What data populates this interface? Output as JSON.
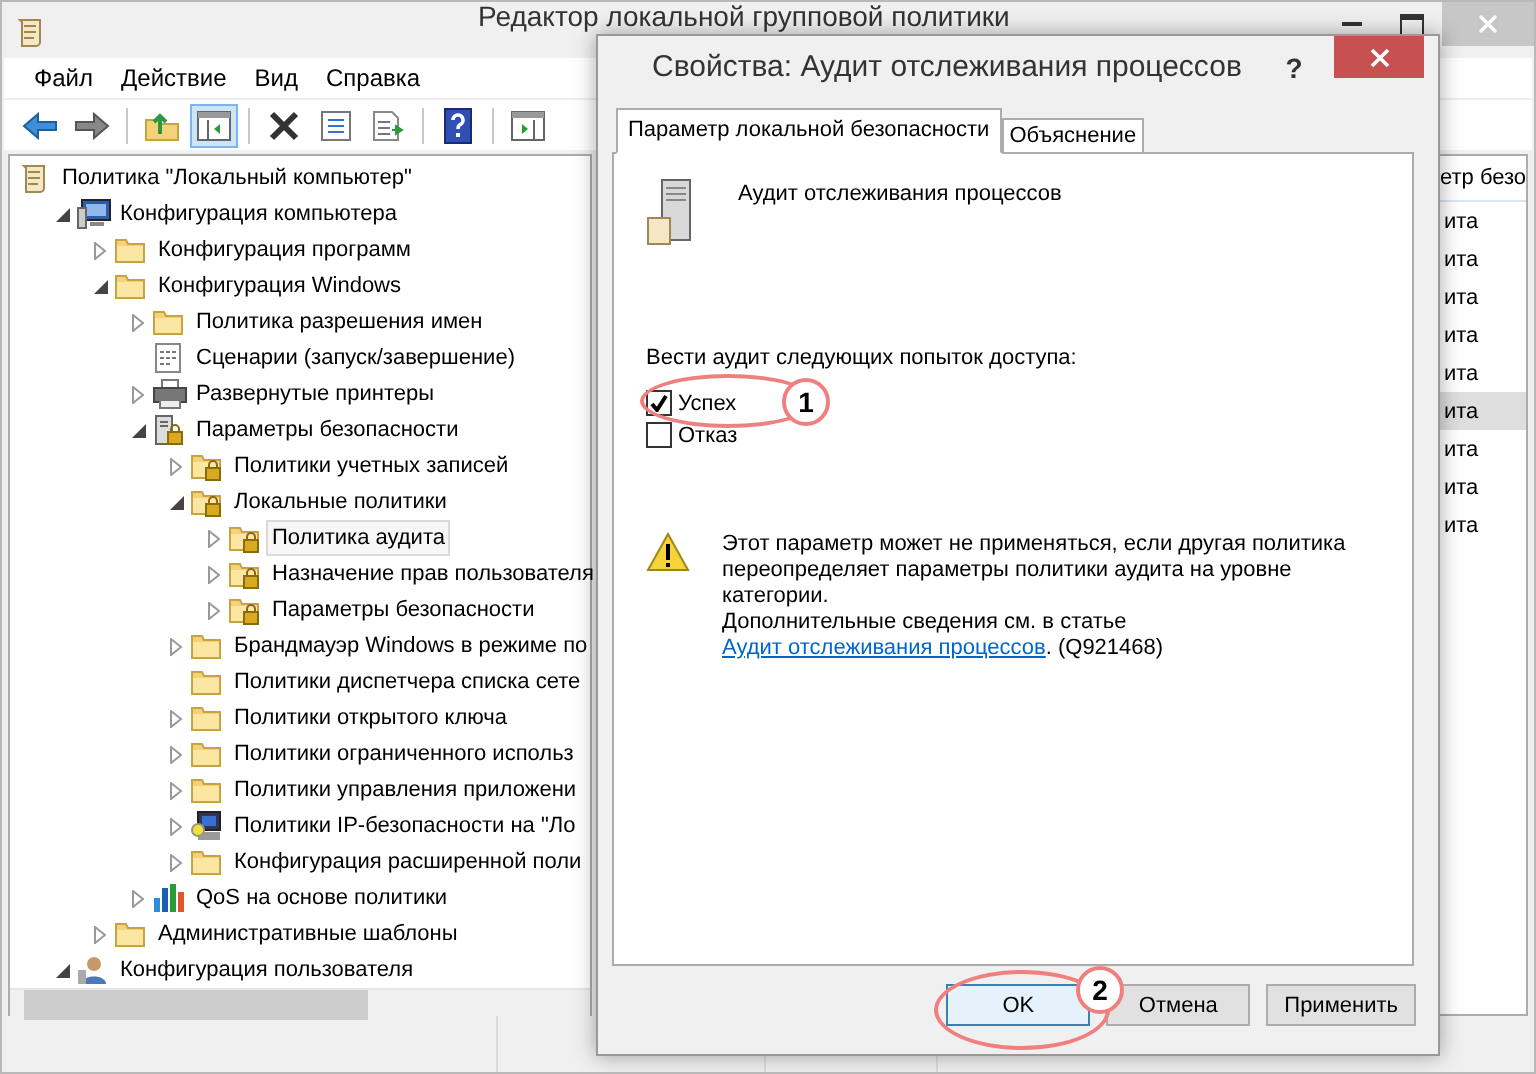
{
  "window": {
    "title": "Редактор локальной групповой политики"
  },
  "menu": [
    "Файл",
    "Действие",
    "Вид",
    "Справка"
  ],
  "toolbar": [
    {
      "kind": "back",
      "pressed": false
    },
    {
      "kind": "forward",
      "pressed": false
    },
    {
      "kind": "up",
      "pressed": false
    },
    {
      "kind": "tree-toggle",
      "pressed": true
    },
    {
      "kind": "delete",
      "pressed": false
    },
    {
      "kind": "properties",
      "pressed": false
    },
    {
      "kind": "export",
      "pressed": false
    },
    {
      "kind": "help",
      "pressed": false
    },
    {
      "kind": "action-pane",
      "pressed": false
    }
  ],
  "tree": [
    {
      "label": "Политика \"Локальный компьютер\"",
      "kind": "scroll",
      "selected": false,
      "children": [
        {
          "label": "Конфигурация компьютера",
          "kind": "computer",
          "expanded": true,
          "selected": false,
          "children": [
            {
              "label": "Конфигурация программ",
              "kind": "folder",
              "expanded": false,
              "selected": false
            },
            {
              "label": "Конфигурация Windows",
              "kind": "folder",
              "expanded": true,
              "selected": false,
              "children": [
                {
                  "label": "Политика разрешения имен",
                  "kind": "folder",
                  "expanded": false,
                  "selected": false
                },
                {
                  "label": "Сценарии (запуск/завершение)",
                  "kind": "script",
                  "selected": false
                },
                {
                  "label": "Развернутые принтеры",
                  "kind": "printer",
                  "expanded": false,
                  "selected": false
                },
                {
                  "label": "Параметры безопасности",
                  "kind": "server-lock",
                  "expanded": true,
                  "selected": false,
                  "children": [
                    {
                      "label": "Политики учетных записей",
                      "kind": "locked-folder",
                      "expanded": false,
                      "selected": false
                    },
                    {
                      "label": "Локальные политики",
                      "kind": "locked-folder",
                      "expanded": true,
                      "selected": false,
                      "children": [
                        {
                          "label": "Политика аудита",
                          "kind": "locked-folder",
                          "expanded": false,
                          "selected": true
                        },
                        {
                          "label": "Назначение прав пользователя",
                          "kind": "locked-folder",
                          "expanded": false,
                          "selected": false
                        },
                        {
                          "label": "Параметры безопасности",
                          "kind": "locked-folder",
                          "expanded": false,
                          "selected": false
                        }
                      ]
                    },
                    {
                      "label": "Брандмауэр Windows в режиме по",
                      "kind": "folder",
                      "expanded": false,
                      "selected": false
                    },
                    {
                      "label": "Политики диспетчера списка сете",
                      "kind": "folder",
                      "selected": false
                    },
                    {
                      "label": "Политики открытого ключа",
                      "kind": "folder",
                      "expanded": false,
                      "selected": false
                    },
                    {
                      "label": "Политики ограниченного использ",
                      "kind": "folder",
                      "expanded": false,
                      "selected": false
                    },
                    {
                      "label": "Политики управления приложени",
                      "kind": "folder",
                      "expanded": false,
                      "selected": false
                    },
                    {
                      "label": "Политики IP-безопасности на \"Ло",
                      "kind": "ip-security",
                      "expanded": false,
                      "selected": false
                    },
                    {
                      "label": "Конфигурация расширенной поли",
                      "kind": "folder",
                      "expanded": false,
                      "selected": false
                    }
                  ]
                },
                {
                  "label": "QoS на основе политики",
                  "kind": "qos",
                  "expanded": false,
                  "selected": false
                }
              ]
            },
            {
              "label": "Административные шаблоны",
              "kind": "folder",
              "expanded": false,
              "selected": false
            }
          ]
        },
        {
          "label": "Конфигурация пользователя",
          "kind": "user",
          "expanded": true,
          "selected": false
        }
      ]
    }
  ],
  "right_list": {
    "header": "етр безо",
    "rows": [
      {
        "text": "ита",
        "selected": false
      },
      {
        "text": "ита",
        "selected": false
      },
      {
        "text": "ита",
        "selected": false
      },
      {
        "text": "ита",
        "selected": false
      },
      {
        "text": "ита",
        "selected": false
      },
      {
        "text": "ита",
        "selected": true
      },
      {
        "text": "ита",
        "selected": false
      },
      {
        "text": "ита",
        "selected": false
      },
      {
        "text": "ита",
        "selected": false
      }
    ]
  },
  "dialog": {
    "title": "Свойства: Аудит отслеживания процессов",
    "help": "?",
    "tabs": [
      {
        "label": "Параметр локальной безопасности",
        "selected": true
      },
      {
        "label": "Объяснение",
        "selected": false
      }
    ],
    "heading": "Аудит отслеживания процессов",
    "audit_label": "Вести аудит следующих попыток доступа:",
    "options": [
      {
        "label": "Успех",
        "checked": true
      },
      {
        "label": "Отказ",
        "checked": false
      }
    ],
    "warning": "Этот параметр может не применяться, если другая политика переопределяет параметры политики аудита на уровне категории.",
    "more_info": {
      "before": "Дополнительные сведения см. в статье ",
      "link": "Аудит отслеживания процессов",
      "after": ". (Q921468)"
    },
    "buttons": [
      {
        "label": "OK",
        "default": true
      },
      {
        "label": "Отмена",
        "default": false
      },
      {
        "label": "Применить",
        "default": false
      }
    ]
  },
  "callouts": [
    {
      "label": "1"
    },
    {
      "label": "2"
    }
  ]
}
